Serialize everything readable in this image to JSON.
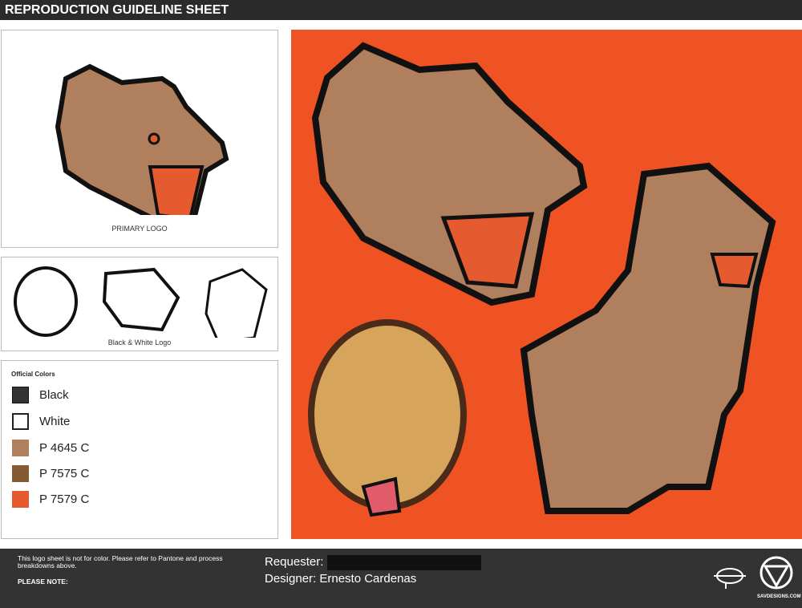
{
  "header": {
    "title": "REPRODUCTION GUIDELINE SHEET"
  },
  "primary": {
    "caption": "PRIMARY LOGO"
  },
  "bw": {
    "caption": "Black & White Logo"
  },
  "colors": {
    "title": "Official Colors",
    "items": [
      {
        "label": "Black",
        "hex": "#333333"
      },
      {
        "label": "White",
        "hex": "#ffffff"
      },
      {
        "label": "P 4645 C",
        "hex": "#b07f5d"
      },
      {
        "label": "P 7575 C",
        "hex": "#855c32"
      },
      {
        "label": "P 7579 C",
        "hex": "#e55a2f"
      }
    ]
  },
  "showcase": {
    "background": "#ef5323"
  },
  "footer": {
    "note": "This logo sheet is not for color. Please refer to Pantone and process breakdowns above.",
    "please_note": "PLEASE NOTE:",
    "requester_label": "Requester:",
    "designer": "Designer: Ernesto Cardenas",
    "brand": "SAVDESIGNS.COM"
  }
}
